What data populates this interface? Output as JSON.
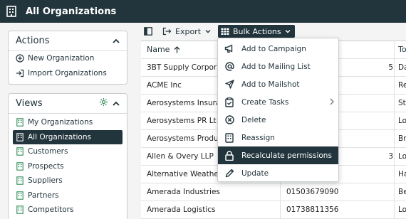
{
  "header": {
    "title": "All Organizations",
    "icon": "building-icon"
  },
  "actions_panel": {
    "title": "Actions",
    "items": [
      {
        "label": "New Organization",
        "icon": "plus-circle-icon"
      },
      {
        "label": "Import Organizations",
        "icon": "import-icon"
      }
    ]
  },
  "views_panel": {
    "title": "Views",
    "items": [
      {
        "label": "My Organizations"
      },
      {
        "label": "All Organizations",
        "active": true
      },
      {
        "label": "Customers"
      },
      {
        "label": "Prospects"
      },
      {
        "label": "Suppliers"
      },
      {
        "label": "Partners"
      },
      {
        "label": "Competitors"
      }
    ]
  },
  "toolbar": {
    "export_label": "Export",
    "bulk_label": "Bulk Actions"
  },
  "grid": {
    "columns": [
      "Name",
      "",
      "To"
    ],
    "rows": [
      {
        "name": "3BT Supply Corpora",
        "phone": "5",
        "c3": "Da"
      },
      {
        "name": "ACME Inc",
        "phone": "",
        "c3": "Re"
      },
      {
        "name": "Aerosystems Insura",
        "phone": "",
        "c3": "St"
      },
      {
        "name": "Aerosystems PR Lt",
        "phone": "",
        "c3": "Lo"
      },
      {
        "name": "Aerosystems Produ",
        "phone": "",
        "c3": "Br"
      },
      {
        "name": "Allen & Overy LLP",
        "phone": "3",
        "c3": "Lo"
      },
      {
        "name": "Alternative Weathe",
        "phone": "",
        "c3": "Ha"
      },
      {
        "name": "Amerada Industries",
        "phone": "01503679090",
        "c3": "Be"
      },
      {
        "name": "Amerada Logistics",
        "phone": "01738811356",
        "c3": "Lo"
      }
    ]
  },
  "bulk_menu": {
    "items": [
      {
        "label": "Add to Campaign",
        "icon": "megaphone-icon"
      },
      {
        "label": "Add to Mailing List",
        "icon": "at-icon"
      },
      {
        "label": "Add to Mailshot",
        "icon": "send-icon"
      },
      {
        "label": "Create Tasks",
        "icon": "clipboard-icon",
        "submenu": true
      },
      {
        "label": "Delete",
        "icon": "delete-circle-icon"
      },
      {
        "label": "Reassign",
        "icon": "reassign-icon"
      },
      {
        "label": "Recalculate permissions",
        "icon": "lock-icon",
        "highlighted": true
      },
      {
        "label": "Update",
        "icon": "pencil-icon"
      }
    ]
  }
}
